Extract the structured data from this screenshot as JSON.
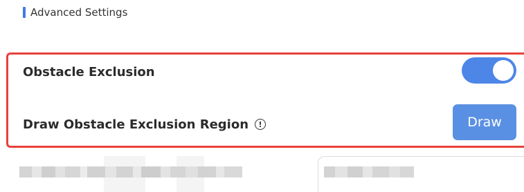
{
  "section": {
    "title": "Advanced Settings",
    "accent_color": "#3f7be6"
  },
  "settings": {
    "obstacle_exclusion": {
      "label": "Obstacle Exclusion",
      "toggle_on": true,
      "toggle_color": "#4d86e6"
    },
    "draw_region": {
      "label": "Draw Obstacle Exclusion Region",
      "info_icon": "info-circle-icon",
      "button_label": "Draw",
      "button_color": "#5a90e3"
    }
  },
  "highlight": {
    "color": "#e8403a"
  }
}
